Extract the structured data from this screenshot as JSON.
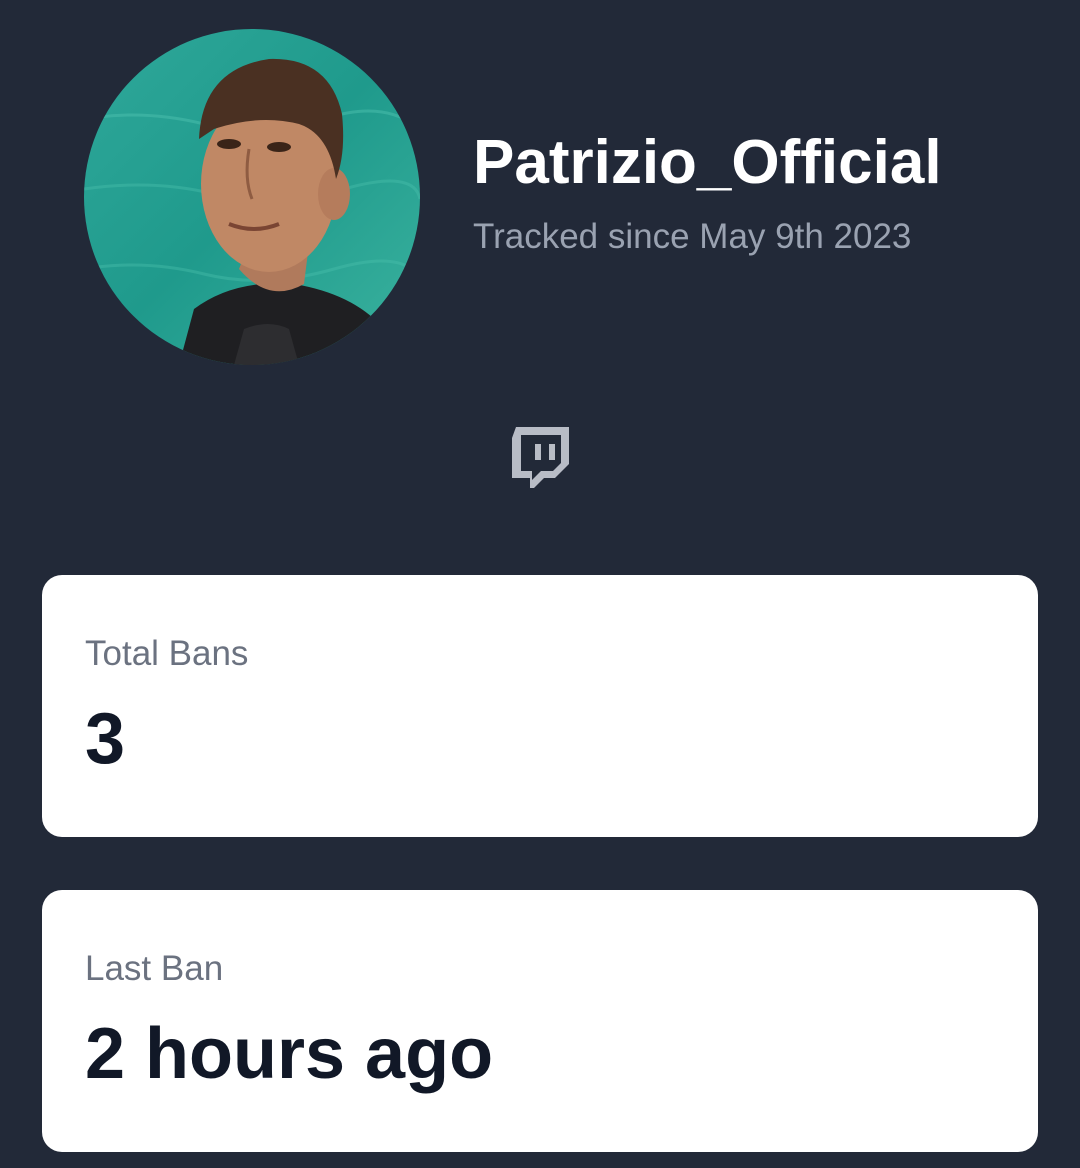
{
  "profile": {
    "username": "Patrizio_Official",
    "tracked_since": "Tracked since May 9th 2023",
    "avatar_icon": "profile-photo",
    "platform_icon": "twitch-icon"
  },
  "stats": {
    "total_bans_label": "Total Bans",
    "total_bans_value": "3",
    "last_ban_label": "Last Ban",
    "last_ban_value": "2 hours ago"
  },
  "colors": {
    "background": "#222938",
    "card": "#ffffff",
    "muted_text": "#9aa2b1",
    "card_label": "#6b7280",
    "card_value": "#111827",
    "icon": "#b8bcc6"
  }
}
